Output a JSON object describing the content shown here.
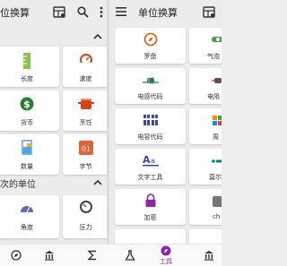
{
  "left": {
    "appbar": {
      "title": "位换算"
    },
    "section_recent": {
      "title": "次的单位"
    },
    "cards": [
      {
        "label": "长度",
        "icon": "ruler-icon"
      },
      {
        "label": "速度",
        "icon": "speedometer-icon"
      },
      {
        "label": "货币",
        "icon": "dollar-icon"
      },
      {
        "label": "烹饪",
        "icon": "cooking-pot-icon"
      },
      {
        "label": "数量",
        "icon": "beaker-icon"
      },
      {
        "label": "字节",
        "icon": "byte-icon"
      },
      {
        "label": "角度",
        "icon": "protractor-icon"
      },
      {
        "label": "压力",
        "icon": "gauge-icon"
      }
    ]
  },
  "right": {
    "appbar": {
      "title": "单位换算"
    },
    "cards": [
      {
        "label": "罗盘",
        "icon": "compass-icon"
      },
      {
        "label": "气泡",
        "icon": "bubble-level-icon"
      },
      {
        "label": "电感代码",
        "icon": "inductor-icon"
      },
      {
        "label": "电阻",
        "icon": "resistor-icon"
      },
      {
        "label": "电容代码",
        "icon": "capacitor-icon"
      },
      {
        "label": "周",
        "icon": "periodic-icon"
      },
      {
        "label": "文字工具",
        "icon": "text-tool-icon"
      },
      {
        "label": "莫尔",
        "icon": "morse-icon"
      },
      {
        "label": "加密",
        "icon": "lock-icon"
      },
      {
        "label": "ch",
        "icon": "misc-icon"
      }
    ]
  },
  "bottom_nav": {
    "items": [
      {
        "label": "",
        "icon": "compass-tab-icon"
      },
      {
        "label": "",
        "icon": "bank-icon"
      },
      {
        "label": "",
        "icon": "sigma-icon"
      },
      {
        "label": "",
        "icon": "flask-icon"
      },
      {
        "label": "工具",
        "icon": "tools-icon",
        "active": true
      },
      {
        "label": "",
        "icon": "bank-icon"
      }
    ]
  },
  "colors": {
    "active": "#8e24aa",
    "ruler": "#8bc34a",
    "speed": "#d84315",
    "dollar": "#2e7d32",
    "pot": "#d84315",
    "beaker": "#4fa3e0",
    "byte": "#e5603b",
    "compass": "#e65100",
    "inductor": "#00897b",
    "capacitor": "#3949ab",
    "text": "#3949ab",
    "lock": "#8e24aa"
  }
}
